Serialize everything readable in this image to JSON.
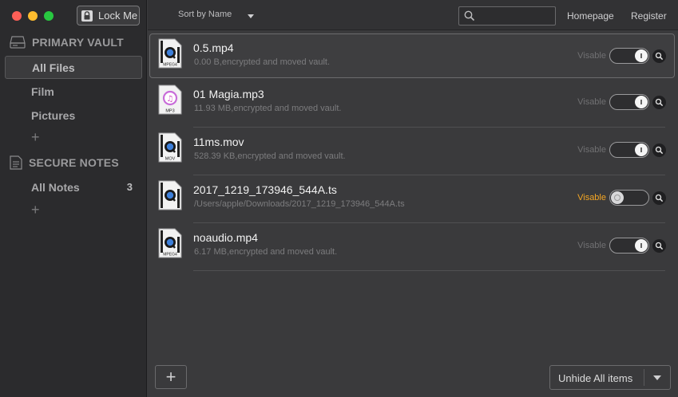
{
  "toolbar": {
    "lock_label": "Lock Me",
    "sort_label": "Sort by Name",
    "search_placeholder": "",
    "homepage": "Homepage",
    "register": "Register"
  },
  "sidebar": {
    "primary_vault": "PRIMARY VAULT",
    "vault_items": [
      {
        "label": "All Files",
        "active": true
      },
      {
        "label": "Film"
      },
      {
        "label": "Pictures"
      }
    ],
    "secure_notes": "SECURE NOTES",
    "notes_items": [
      {
        "label": "All Notes",
        "count": "3"
      }
    ],
    "add_symbol": "+"
  },
  "files": [
    {
      "name": "0.5.mp4",
      "meta": "0.00 B,encrypted and moved vault.",
      "visibility": "Visable",
      "type": "MPEG4",
      "visible": true,
      "selected": true
    },
    {
      "name": "01 Magia.mp3",
      "meta": "11.93 MB,encrypted and moved vault.",
      "visibility": "Visable",
      "type": "MP3",
      "visible": true
    },
    {
      "name": "11ms.mov",
      "meta": "528.39 KB,encrypted and moved vault.",
      "visibility": "Visable",
      "type": "MOV",
      "visible": true
    },
    {
      "name": "2017_1219_173946_544A.ts",
      "meta": "/Users/apple/Downloads/2017_1219_173946_544A.ts",
      "visibility": "Visable",
      "type": "",
      "visible": false,
      "warn": true
    },
    {
      "name": "noaudio.mp4",
      "meta": "6.17 MB,encrypted and moved vault.",
      "visibility": "Visable",
      "type": "MPEG4",
      "visible": true
    }
  ],
  "bottom": {
    "add_label": "+",
    "unhide_label": "Unhide All items"
  },
  "colors": {
    "accent_warn": "#f5a623",
    "sidebar_bg": "#2b2b2d",
    "main_bg": "#3a3a3c"
  }
}
